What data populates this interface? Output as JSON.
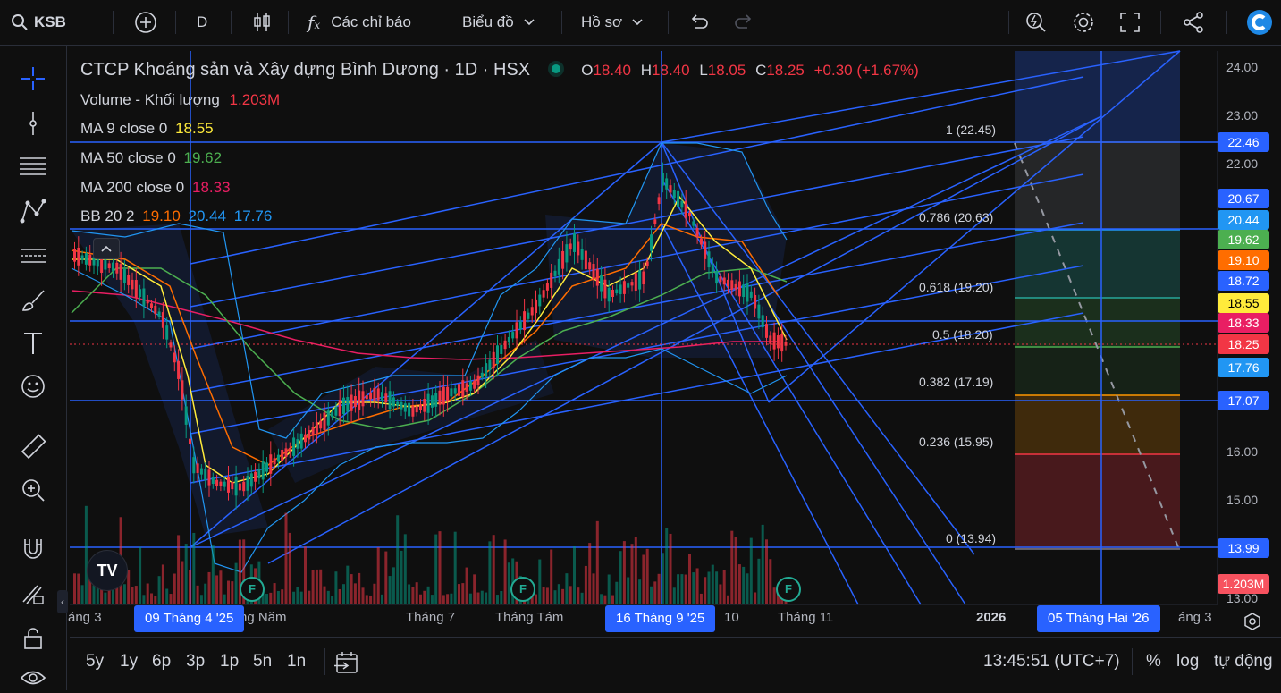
{
  "toolbar": {
    "symbol": "KSB",
    "interval": "D",
    "indicators_label": "Các chỉ báo",
    "chart_label": "Biểu đồ",
    "profile_label": "Hồ sơ"
  },
  "legend": {
    "title": "CTCP Khoáng sản và Xây dựng Bình Dương · 1D · HSX",
    "o_label": "O",
    "o": "18.40",
    "h_label": "H",
    "h": "18.40",
    "l_label": "L",
    "l": "18.05",
    "c_label": "C",
    "c": "18.25",
    "change": "+0.30 (+1.67%)",
    "volume_label": "Volume - Khối lượng",
    "volume": "1.203M",
    "ma9_label": "MA 9 close 0",
    "ma9": "18.55",
    "ma50_label": "MA 50 close 0",
    "ma50": "19.62",
    "ma200_label": "MA 200 close 0",
    "ma200": "18.33",
    "bb_label": "BB 20 2",
    "bb_basis": "19.10",
    "bb_upper": "20.44",
    "bb_lower": "17.76"
  },
  "price_axis": [
    "24.00",
    "23.00",
    "22.00",
    "16.00",
    "15.00",
    "13.00"
  ],
  "price_labels": [
    {
      "text": "22.46",
      "color": "#2962ff"
    },
    {
      "text": "20.67",
      "color": "#2962ff"
    },
    {
      "text": "20.44",
      "color": "#2196f3"
    },
    {
      "text": "19.62",
      "color": "#4caf50"
    },
    {
      "text": "19.10",
      "color": "#ff6d00"
    },
    {
      "text": "18.72",
      "color": "#2962ff"
    },
    {
      "text": "18.55",
      "color": "#ffeb3b"
    },
    {
      "text": "18.33",
      "color": "#e91e63"
    },
    {
      "text": "18.25",
      "color": "#f23645"
    },
    {
      "text": "17.76",
      "color": "#2196f3"
    },
    {
      "text": "17.07",
      "color": "#2962ff"
    },
    {
      "text": "13.99",
      "color": "#2962ff"
    },
    {
      "text": "1.203M",
      "color": "#f7525f"
    }
  ],
  "fib": [
    {
      "label": "1 (22.45)",
      "color": "#787b86"
    },
    {
      "label": "0.786 (20.63)",
      "color": "#2196f3"
    },
    {
      "label": "0.618 (19.20)",
      "color": "#26a69a"
    },
    {
      "label": "0.5 (18.20)",
      "color": "#4caf50"
    },
    {
      "label": "0.382 (17.19)",
      "color": "#ff9800"
    },
    {
      "label": "0.236 (15.95)",
      "color": "#f23645"
    },
    {
      "label": "0 (13.94)",
      "color": "#787b86"
    }
  ],
  "time_axis": {
    "labels": [
      "áng 3",
      "ng Năm",
      "Tháng 7",
      "Tháng Tám",
      "10",
      "Tháng 11",
      "2026",
      "áng 3"
    ],
    "highlight1": "09 Tháng 4 '25",
    "highlight2": "16 Tháng 9 '25",
    "highlight3": "05 Tháng Hai '26"
  },
  "bottom": {
    "ranges": [
      "5y",
      "1y",
      "6p",
      "3p",
      "1p",
      "5n",
      "1n"
    ],
    "time": "13:45:51 (UTC+7)",
    "percent": "%",
    "log": "log",
    "auto": "tự động"
  },
  "earnings_marker": "F",
  "watermark": "TV"
}
